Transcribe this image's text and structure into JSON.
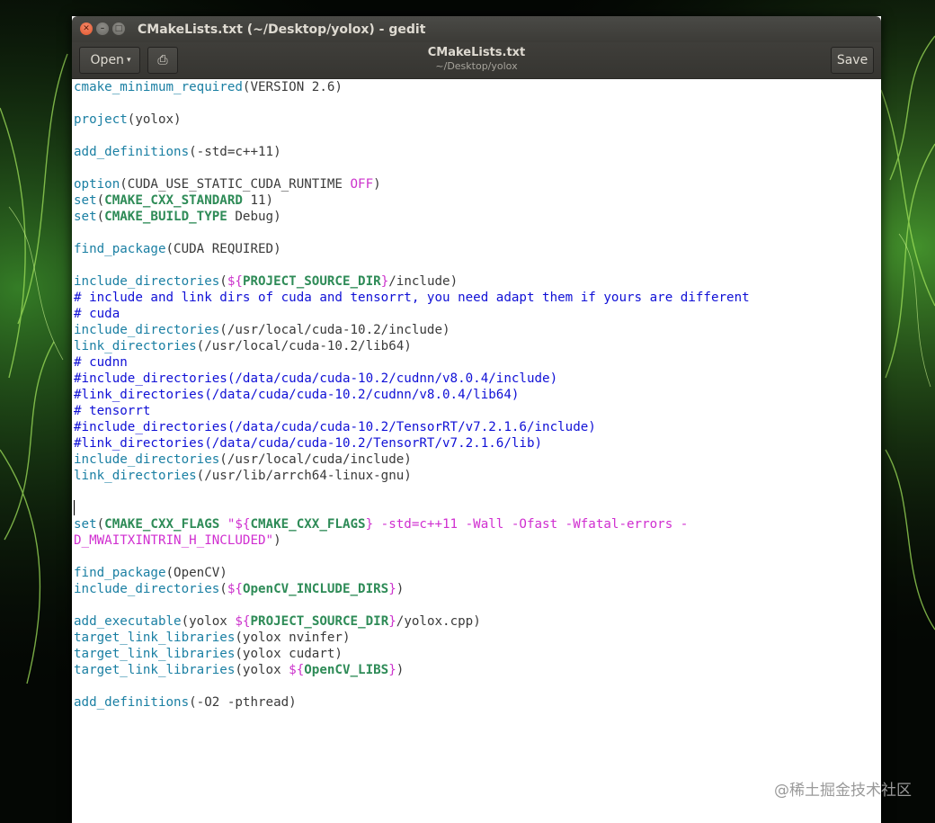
{
  "window": {
    "title": "CMakeLists.txt (~/Desktop/yolox) - gedit",
    "close_glyph": "✕",
    "min_glyph": "–",
    "max_glyph": "□"
  },
  "header": {
    "open_label": "Open",
    "caret_glyph": "▾",
    "pin_glyph": "⎙",
    "file_title": "CMakeLists.txt",
    "file_path": "~/Desktop/yolox",
    "save_label": "Save"
  },
  "colors": {
    "function": "#1a7fa3",
    "comment": "#1010d6",
    "variable": "#2e8b57",
    "keyword": "#cc33cc",
    "string": "#d02fd0"
  },
  "editor": {
    "lines": [
      [
        [
          "fn",
          "cmake_minimum_required"
        ],
        [
          "pl",
          "(VERSION 2.6)"
        ]
      ],
      [],
      [
        [
          "fn",
          "project"
        ],
        [
          "pl",
          "(yolox)"
        ]
      ],
      [],
      [
        [
          "fn",
          "add_definitions"
        ],
        [
          "pl",
          "(-std=c++11)"
        ]
      ],
      [],
      [
        [
          "fn",
          "option"
        ],
        [
          "pl",
          "(CUDA_USE_STATIC_CUDA_RUNTIME "
        ],
        [
          "kw",
          "OFF"
        ],
        [
          "pl",
          ")"
        ]
      ],
      [
        [
          "fn",
          "set"
        ],
        [
          "pl",
          "("
        ],
        [
          "vr",
          "CMAKE_CXX_STANDARD"
        ],
        [
          "pl",
          " 11)"
        ]
      ],
      [
        [
          "fn",
          "set"
        ],
        [
          "pl",
          "("
        ],
        [
          "vr",
          "CMAKE_BUILD_TYPE"
        ],
        [
          "pl",
          " Debug)"
        ]
      ],
      [],
      [
        [
          "fn",
          "find_package"
        ],
        [
          "pl",
          "(CUDA REQUIRED)"
        ]
      ],
      [],
      [
        [
          "fn",
          "include_directories"
        ],
        [
          "pl",
          "("
        ],
        [
          "kw",
          "${"
        ],
        [
          "vr",
          "PROJECT_SOURCE_DIR"
        ],
        [
          "kw",
          "}"
        ],
        [
          "pl",
          "/include)"
        ]
      ],
      [
        [
          "cm",
          "# include and link dirs of cuda and tensorrt, you need adapt them if yours are different"
        ]
      ],
      [
        [
          "cm",
          "# cuda"
        ]
      ],
      [
        [
          "fn",
          "include_directories"
        ],
        [
          "pl",
          "(/usr/local/cuda-10.2/include)"
        ]
      ],
      [
        [
          "fn",
          "link_directories"
        ],
        [
          "pl",
          "(/usr/local/cuda-10.2/lib64)"
        ]
      ],
      [
        [
          "cm",
          "# cudnn"
        ]
      ],
      [
        [
          "cm",
          "#include_directories(/data/cuda/cuda-10.2/cudnn/v8.0.4/include)"
        ]
      ],
      [
        [
          "cm",
          "#link_directories(/data/cuda/cuda-10.2/cudnn/v8.0.4/lib64)"
        ]
      ],
      [
        [
          "cm",
          "# tensorrt"
        ]
      ],
      [
        [
          "cm",
          "#include_directories(/data/cuda/cuda-10.2/TensorRT/v7.2.1.6/include)"
        ]
      ],
      [
        [
          "cm",
          "#link_directories(/data/cuda/cuda-10.2/TensorRT/v7.2.1.6/lib)"
        ]
      ],
      [
        [
          "fn",
          "include_directories"
        ],
        [
          "pl",
          "(/usr/local/cuda/include)"
        ]
      ],
      [
        [
          "fn",
          "link_directories"
        ],
        [
          "pl",
          "(/usr/lib/arrch64-linux-gnu)"
        ]
      ],
      [],
      [
        [
          "cursor",
          ""
        ]
      ],
      [
        [
          "fn",
          "set"
        ],
        [
          "pl",
          "("
        ],
        [
          "vr",
          "CMAKE_CXX_FLAGS"
        ],
        [
          "pl",
          " "
        ],
        [
          "st",
          "\"${"
        ],
        [
          "vr",
          "CMAKE_CXX_FLAGS"
        ],
        [
          "st",
          "} -std=c++11 -Wall -Ofast -Wfatal-errors -"
        ]
      ],
      [
        [
          "st",
          "D_MWAITXINTRIN_H_INCLUDED\""
        ],
        [
          "pl",
          ")"
        ]
      ],
      [],
      [
        [
          "fn",
          "find_package"
        ],
        [
          "pl",
          "(OpenCV)"
        ]
      ],
      [
        [
          "fn",
          "include_directories"
        ],
        [
          "pl",
          "("
        ],
        [
          "kw",
          "${"
        ],
        [
          "vr",
          "OpenCV_INCLUDE_DIRS"
        ],
        [
          "kw",
          "}"
        ],
        [
          "pl",
          ")"
        ]
      ],
      [],
      [
        [
          "fn",
          "add_executable"
        ],
        [
          "pl",
          "(yolox "
        ],
        [
          "kw",
          "${"
        ],
        [
          "vr",
          "PROJECT_SOURCE_DIR"
        ],
        [
          "kw",
          "}"
        ],
        [
          "pl",
          "/yolox.cpp)"
        ]
      ],
      [
        [
          "fn",
          "target_link_libraries"
        ],
        [
          "pl",
          "(yolox nvinfer)"
        ]
      ],
      [
        [
          "fn",
          "target_link_libraries"
        ],
        [
          "pl",
          "(yolox cudart)"
        ]
      ],
      [
        [
          "fn",
          "target_link_libraries"
        ],
        [
          "pl",
          "(yolox "
        ],
        [
          "kw",
          "${"
        ],
        [
          "vr",
          "OpenCV_LIBS"
        ],
        [
          "kw",
          "}"
        ],
        [
          "pl",
          ")"
        ]
      ],
      [],
      [
        [
          "fn",
          "add_definitions"
        ],
        [
          "pl",
          "(-O2 -pthread)"
        ]
      ]
    ]
  },
  "watermark": "@稀土掘金技术社区"
}
